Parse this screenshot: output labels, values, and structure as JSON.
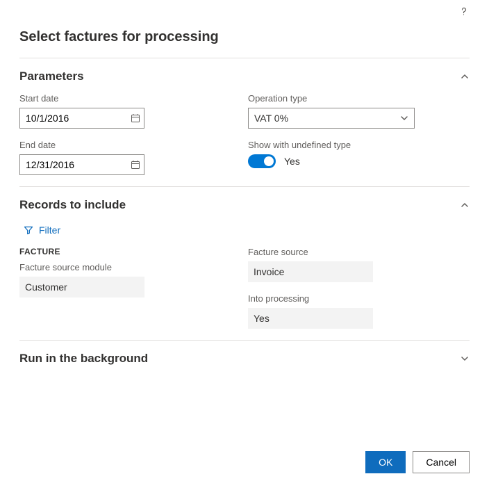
{
  "title": "Select factures for processing",
  "sections": {
    "parameters": {
      "title": "Parameters",
      "expanded": true
    },
    "records": {
      "title": "Records to include",
      "expanded": true
    },
    "background": {
      "title": "Run in the background",
      "expanded": false
    }
  },
  "parameters": {
    "start_date": {
      "label": "Start date",
      "value": "10/1/2016"
    },
    "end_date": {
      "label": "End date",
      "value": "12/31/2016"
    },
    "operation_type": {
      "label": "Operation type",
      "value": "VAT 0%"
    },
    "show_undefined": {
      "label": "Show with undefined type",
      "value": true,
      "value_text": "Yes"
    }
  },
  "records": {
    "filter_label": "Filter",
    "facture_heading": "FACTURE",
    "left": {
      "facture_source_module": {
        "label": "Facture source module",
        "value": "Customer"
      }
    },
    "right": {
      "facture_source": {
        "label": "Facture source",
        "value": "Invoice"
      },
      "into_processing": {
        "label": "Into processing",
        "value": "Yes"
      }
    }
  },
  "buttons": {
    "ok": "OK",
    "cancel": "Cancel"
  }
}
